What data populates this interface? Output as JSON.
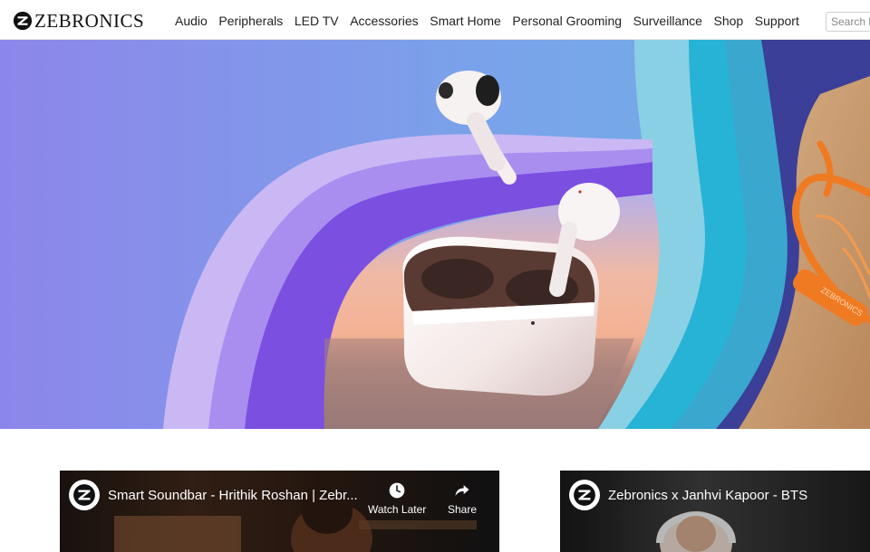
{
  "header": {
    "brand": "ZEBRONICS",
    "nav": [
      {
        "label": "Audio"
      },
      {
        "label": "Peripherals"
      },
      {
        "label": "LED TV"
      },
      {
        "label": "Accessories"
      },
      {
        "label": "Smart Home"
      },
      {
        "label": "Personal Grooming"
      },
      {
        "label": "Surveillance"
      },
      {
        "label": "Shop"
      },
      {
        "label": "Support"
      }
    ],
    "search": {
      "placeholder": "Search here...",
      "value": ""
    }
  },
  "hero": {
    "product_text": "ZEBRONICS",
    "colors": {
      "sky_left": "#8f8aec",
      "sky_right": "#74a8e8",
      "band_purple": "#7b4fe0",
      "band_teal": "#2bb6d8",
      "band_navy": "#3c3f9a",
      "neckband": "#f07a22",
      "wood": "#c99a6b"
    }
  },
  "videos": [
    {
      "title": "Smart Soundbar - Hrithik Roshan | Zebr...",
      "watch_later": "Watch Later",
      "share": "Share"
    },
    {
      "title": "Zebronics x Janhvi Kapoor - BTS"
    }
  ]
}
